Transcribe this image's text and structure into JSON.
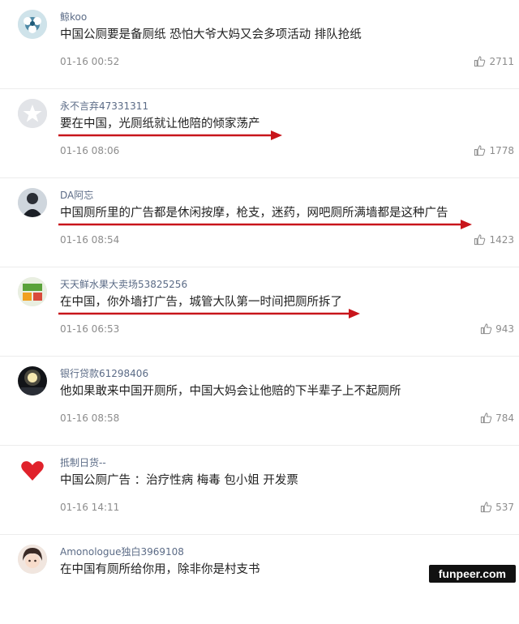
{
  "comments": [
    {
      "user": "鲸koo",
      "text": "中国公厕要是备厕纸 恐怕大爷大妈又会多项活动 排队抢纸",
      "time": "01-16 00:52",
      "likes": "2711",
      "avatar": "avatar-flower-icon"
    },
    {
      "user": "永不言弃47331311",
      "text": "要在中国，光厕纸就让他陪的倾家荡产",
      "time": "01-16 08:06",
      "likes": "1778",
      "avatar": "avatar-default-star-icon"
    },
    {
      "user": "DA阿忘",
      "text": "中国厕所里的广告都是休闲按摩，枪支，迷药，网吧厕所满墙都是这种广告",
      "time": "01-16 08:54",
      "likes": "1423",
      "avatar": "avatar-dark-figure-icon"
    },
    {
      "user": "天天鲜水果大卖场53825256",
      "text": "在中国，你外墙打广告，城管大队第一时间把厕所拆了",
      "time": "01-16 06:53",
      "likes": "943",
      "avatar": "avatar-fruit-stall-icon"
    },
    {
      "user": "银行贷款61298406",
      "text": "他如果敢来中国开厕所，中国大妈会让他赔的下半辈子上不起厕所",
      "time": "01-16 08:58",
      "likes": "784",
      "avatar": "avatar-night-light-icon"
    },
    {
      "user": "抵制日货--",
      "text": "中国公厕广告 ：治疗性病 梅毒 包小姐 开发票",
      "time": "01-16 14:11",
      "likes": "537",
      "avatar": "avatar-red-heart-icon"
    },
    {
      "user": "Amonologue独白3969108",
      "text": "在中国有厕所给你用，除非你是村支书",
      "time": "",
      "likes": "",
      "avatar": "avatar-anime-face-icon"
    }
  ],
  "watermark": "funpeer.com",
  "colors": {
    "arrow": "#c8151b",
    "username": "#5b6b86",
    "meta": "#8c8c8c"
  }
}
